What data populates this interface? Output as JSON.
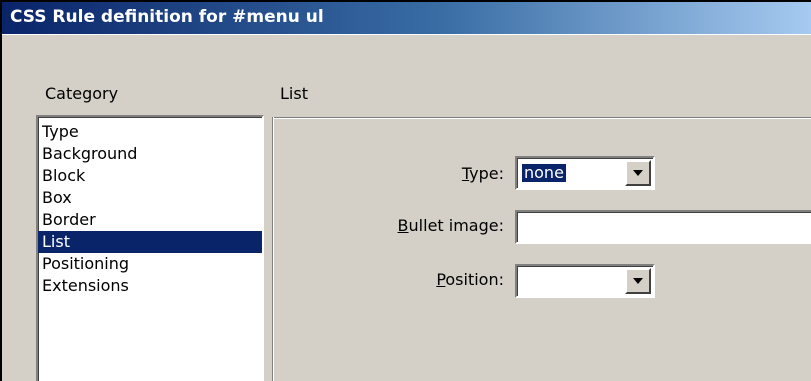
{
  "window": {
    "title": "CSS Rule definition for #menu ul"
  },
  "category": {
    "label": "Category",
    "items": [
      "Type",
      "Background",
      "Block",
      "Box",
      "Border",
      "List",
      "Positioning",
      "Extensions"
    ],
    "selected": "List"
  },
  "panel": {
    "title": "List",
    "type_field": {
      "label_mnemonic": "T",
      "label_rest": "ype:",
      "value": "none"
    },
    "bullet_image_field": {
      "label_mnemonic": "B",
      "label_rest": "ullet image:",
      "value": ""
    },
    "position_field": {
      "label_mnemonic": "P",
      "label_rest": "osition:",
      "value": ""
    }
  },
  "colors": {
    "title_bar": "#0a246a",
    "selection": "#0a246a",
    "face": "#d4d0c8"
  }
}
